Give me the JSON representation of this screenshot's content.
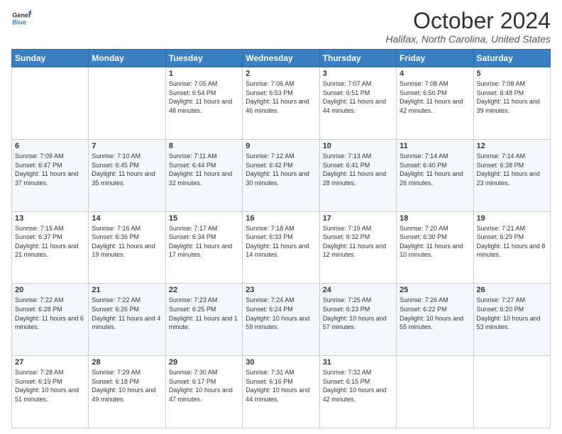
{
  "logo": {
    "line1": "General",
    "line2": "Blue",
    "icon_color": "#3a7fc1"
  },
  "title": "October 2024",
  "subtitle": "Halifax, North Carolina, United States",
  "days_of_week": [
    "Sunday",
    "Monday",
    "Tuesday",
    "Wednesday",
    "Thursday",
    "Friday",
    "Saturday"
  ],
  "weeks": [
    [
      {
        "day": "",
        "sunrise": "",
        "sunset": "",
        "daylight": ""
      },
      {
        "day": "",
        "sunrise": "",
        "sunset": "",
        "daylight": ""
      },
      {
        "day": "1",
        "sunrise": "Sunrise: 7:05 AM",
        "sunset": "Sunset: 6:54 PM",
        "daylight": "Daylight: 11 hours and 48 minutes."
      },
      {
        "day": "2",
        "sunrise": "Sunrise: 7:06 AM",
        "sunset": "Sunset: 6:53 PM",
        "daylight": "Daylight: 11 hours and 46 minutes."
      },
      {
        "day": "3",
        "sunrise": "Sunrise: 7:07 AM",
        "sunset": "Sunset: 6:51 PM",
        "daylight": "Daylight: 11 hours and 44 minutes."
      },
      {
        "day": "4",
        "sunrise": "Sunrise: 7:08 AM",
        "sunset": "Sunset: 6:50 PM",
        "daylight": "Daylight: 11 hours and 42 minutes."
      },
      {
        "day": "5",
        "sunrise": "Sunrise: 7:08 AM",
        "sunset": "Sunset: 6:48 PM",
        "daylight": "Daylight: 11 hours and 39 minutes."
      }
    ],
    [
      {
        "day": "6",
        "sunrise": "Sunrise: 7:09 AM",
        "sunset": "Sunset: 6:47 PM",
        "daylight": "Daylight: 11 hours and 37 minutes."
      },
      {
        "day": "7",
        "sunrise": "Sunrise: 7:10 AM",
        "sunset": "Sunset: 6:45 PM",
        "daylight": "Daylight: 11 hours and 35 minutes."
      },
      {
        "day": "8",
        "sunrise": "Sunrise: 7:11 AM",
        "sunset": "Sunset: 6:44 PM",
        "daylight": "Daylight: 11 hours and 32 minutes."
      },
      {
        "day": "9",
        "sunrise": "Sunrise: 7:12 AM",
        "sunset": "Sunset: 6:42 PM",
        "daylight": "Daylight: 11 hours and 30 minutes."
      },
      {
        "day": "10",
        "sunrise": "Sunrise: 7:13 AM",
        "sunset": "Sunset: 6:41 PM",
        "daylight": "Daylight: 11 hours and 28 minutes."
      },
      {
        "day": "11",
        "sunrise": "Sunrise: 7:14 AM",
        "sunset": "Sunset: 6:40 PM",
        "daylight": "Daylight: 11 hours and 26 minutes."
      },
      {
        "day": "12",
        "sunrise": "Sunrise: 7:14 AM",
        "sunset": "Sunset: 6:38 PM",
        "daylight": "Daylight: 11 hours and 23 minutes."
      }
    ],
    [
      {
        "day": "13",
        "sunrise": "Sunrise: 7:15 AM",
        "sunset": "Sunset: 6:37 PM",
        "daylight": "Daylight: 11 hours and 21 minutes."
      },
      {
        "day": "14",
        "sunrise": "Sunrise: 7:16 AM",
        "sunset": "Sunset: 6:36 PM",
        "daylight": "Daylight: 11 hours and 19 minutes."
      },
      {
        "day": "15",
        "sunrise": "Sunrise: 7:17 AM",
        "sunset": "Sunset: 6:34 PM",
        "daylight": "Daylight: 11 hours and 17 minutes."
      },
      {
        "day": "16",
        "sunrise": "Sunrise: 7:18 AM",
        "sunset": "Sunset: 6:33 PM",
        "daylight": "Daylight: 11 hours and 14 minutes."
      },
      {
        "day": "17",
        "sunrise": "Sunrise: 7:19 AM",
        "sunset": "Sunset: 6:32 PM",
        "daylight": "Daylight: 11 hours and 12 minutes."
      },
      {
        "day": "18",
        "sunrise": "Sunrise: 7:20 AM",
        "sunset": "Sunset: 6:30 PM",
        "daylight": "Daylight: 11 hours and 10 minutes."
      },
      {
        "day": "19",
        "sunrise": "Sunrise: 7:21 AM",
        "sunset": "Sunset: 6:29 PM",
        "daylight": "Daylight: 11 hours and 8 minutes."
      }
    ],
    [
      {
        "day": "20",
        "sunrise": "Sunrise: 7:22 AM",
        "sunset": "Sunset: 6:28 PM",
        "daylight": "Daylight: 11 hours and 6 minutes."
      },
      {
        "day": "21",
        "sunrise": "Sunrise: 7:22 AM",
        "sunset": "Sunset: 6:26 PM",
        "daylight": "Daylight: 11 hours and 4 minutes."
      },
      {
        "day": "22",
        "sunrise": "Sunrise: 7:23 AM",
        "sunset": "Sunset: 6:25 PM",
        "daylight": "Daylight: 11 hours and 1 minute."
      },
      {
        "day": "23",
        "sunrise": "Sunrise: 7:24 AM",
        "sunset": "Sunset: 6:24 PM",
        "daylight": "Daylight: 10 hours and 59 minutes."
      },
      {
        "day": "24",
        "sunrise": "Sunrise: 7:25 AM",
        "sunset": "Sunset: 6:23 PM",
        "daylight": "Daylight: 10 hours and 57 minutes."
      },
      {
        "day": "25",
        "sunrise": "Sunrise: 7:26 AM",
        "sunset": "Sunset: 6:22 PM",
        "daylight": "Daylight: 10 hours and 55 minutes."
      },
      {
        "day": "26",
        "sunrise": "Sunrise: 7:27 AM",
        "sunset": "Sunset: 6:20 PM",
        "daylight": "Daylight: 10 hours and 53 minutes."
      }
    ],
    [
      {
        "day": "27",
        "sunrise": "Sunrise: 7:28 AM",
        "sunset": "Sunset: 6:19 PM",
        "daylight": "Daylight: 10 hours and 51 minutes."
      },
      {
        "day": "28",
        "sunrise": "Sunrise: 7:29 AM",
        "sunset": "Sunset: 6:18 PM",
        "daylight": "Daylight: 10 hours and 49 minutes."
      },
      {
        "day": "29",
        "sunrise": "Sunrise: 7:30 AM",
        "sunset": "Sunset: 6:17 PM",
        "daylight": "Daylight: 10 hours and 47 minutes."
      },
      {
        "day": "30",
        "sunrise": "Sunrise: 7:31 AM",
        "sunset": "Sunset: 6:16 PM",
        "daylight": "Daylight: 10 hours and 44 minutes."
      },
      {
        "day": "31",
        "sunrise": "Sunrise: 7:32 AM",
        "sunset": "Sunset: 6:15 PM",
        "daylight": "Daylight: 10 hours and 42 minutes."
      },
      {
        "day": "",
        "sunrise": "",
        "sunset": "",
        "daylight": ""
      },
      {
        "day": "",
        "sunrise": "",
        "sunset": "",
        "daylight": ""
      }
    ]
  ]
}
